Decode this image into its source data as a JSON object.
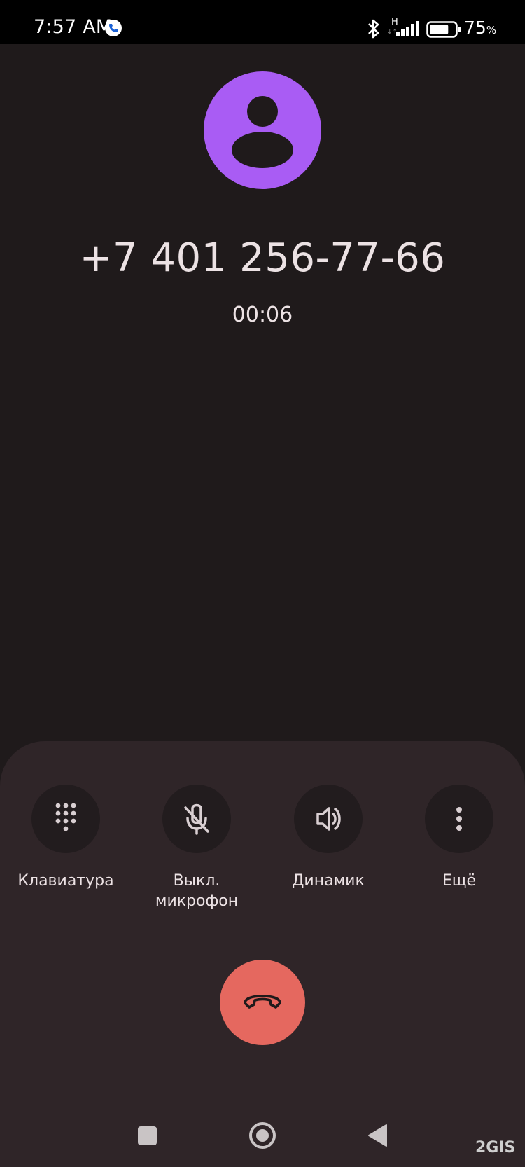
{
  "status_bar": {
    "time": "7:57 AM",
    "network_type": "H",
    "network_arrows": "↓↑",
    "battery_percent": "75",
    "battery_unit": "%",
    "icons": [
      "call-notification-icon",
      "bluetooth-icon",
      "signal-icon",
      "battery-icon"
    ],
    "battery_level": 0.75
  },
  "call": {
    "number": "+7 401 256-77-66",
    "timer": "00:06",
    "avatar_color": "#a95cf4"
  },
  "actions": [
    {
      "label": "Клавиатура",
      "icon": "dialpad-icon"
    },
    {
      "label": "Выкл.",
      "label2": "микрофон",
      "icon": "mic-off-icon"
    },
    {
      "label": "Динамик",
      "icon": "speaker-icon"
    },
    {
      "label": "Ещё",
      "icon": "more-vert-icon"
    }
  ],
  "end_call": {
    "icon": "call-end-icon",
    "color": "#e5685f"
  },
  "nav": {
    "icons": [
      "recents-square-icon",
      "home-circle-icon",
      "back-triangle-icon"
    ]
  },
  "watermark": "2GIS"
}
